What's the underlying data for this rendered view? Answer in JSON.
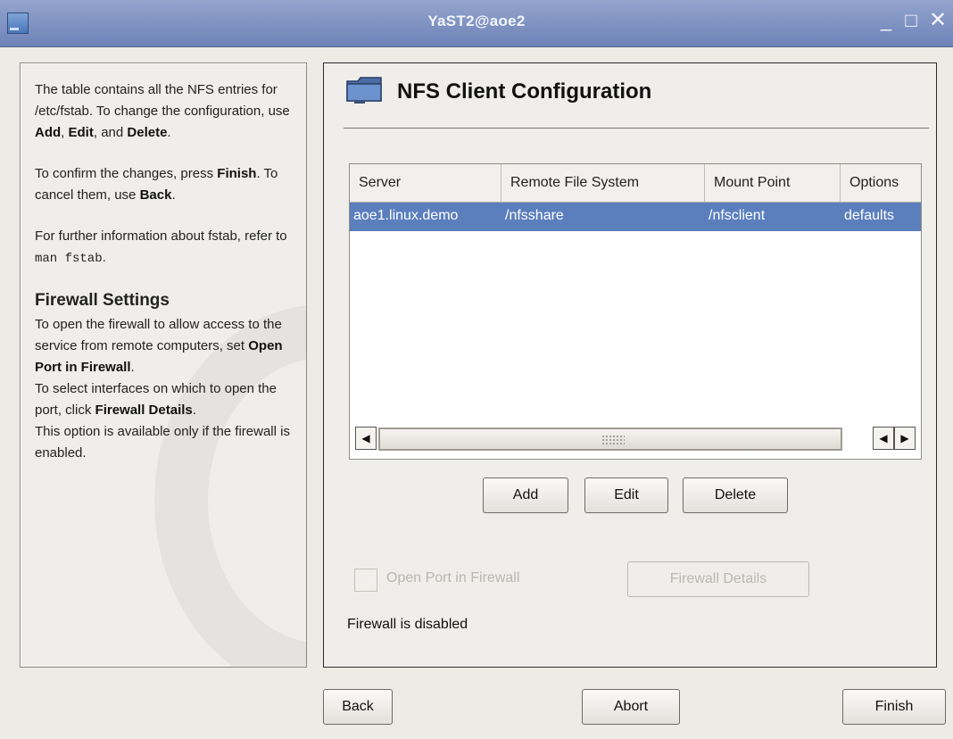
{
  "window": {
    "title": "YaST2@aoe2",
    "minimize": "_",
    "maximize": "□",
    "close": "✕"
  },
  "help": {
    "p1_text": "The table contains all the NFS entries for /etc/fstab. To change the configuration, use",
    "p1_add": "Add",
    "p1_sep1": ", ",
    "p1_edit": "Edit",
    "p1_sep2": ", and ",
    "p1_delete": "Delete",
    "p1_end": ".",
    "p2_text": "To confirm the changes, press",
    "p2_finish": "Finish",
    "p2_mid": ". To cancel them, use",
    "p2_back": "Back",
    "p2_end": ".",
    "p3_text": "For further information about fstab, refer to",
    "p3_cmd": "man fstab",
    "p3_end": ".",
    "fw_title": "Firewall Settings",
    "fw_p1": "To open the firewall to allow access to the service from remote computers, set",
    "fw_p1_bold": "Open Port in Firewall",
    "fw_p1_end": ".",
    "fw_p2": "To select interfaces on which to open the port, click",
    "fw_p2_bold": "Firewall Details",
    "fw_p2_end": ".",
    "fw_p3": "This option is available only if the firewall is enabled."
  },
  "main": {
    "title": "NFS Client Configuration",
    "icon": "folder-icon",
    "table": {
      "columns": [
        "Server",
        "Remote File System",
        "Mount Point",
        "Options"
      ],
      "rows": [
        [
          "aoe1.linux.demo",
          "/nfsshare",
          "/nfsclient",
          "defaults"
        ]
      ]
    },
    "buttons": {
      "add": "Add",
      "edit": "Edit",
      "delete": "Delete"
    },
    "open_port_label": "Open Port in Firewall",
    "open_port_checked": false,
    "firewall_details": "Firewall Details",
    "firewall_status": "Firewall is disabled"
  },
  "footer": {
    "back": "Back",
    "abort": "Abort",
    "finish": "Finish"
  },
  "colors": {
    "titlebar": "#7f92c4",
    "selection": "#5b7fbd",
    "dialog_bg": "#ecebe6"
  }
}
